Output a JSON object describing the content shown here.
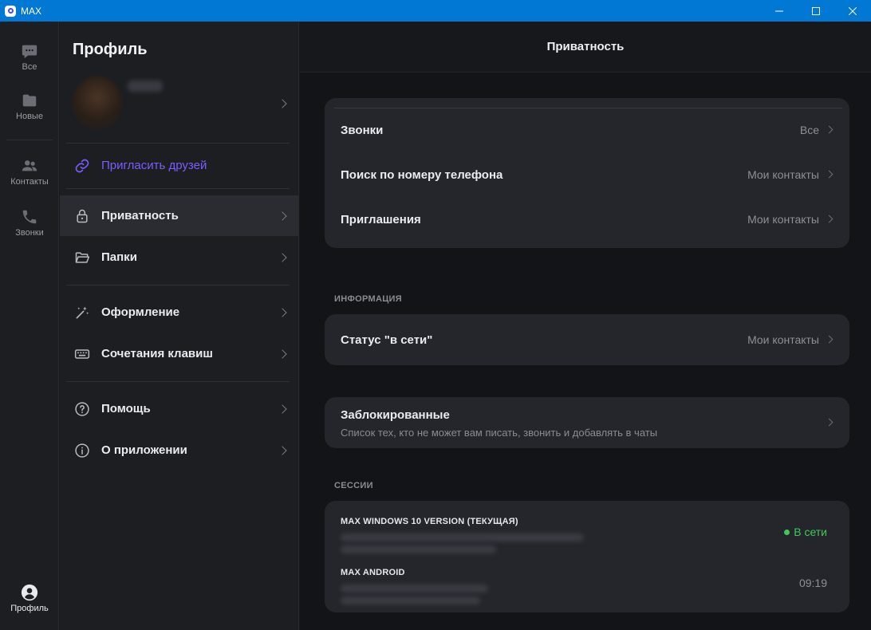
{
  "window": {
    "title": "MAX"
  },
  "rail": {
    "items": [
      {
        "label": "Все",
        "icon": "chat-bubble-icon"
      },
      {
        "label": "Новые",
        "icon": "folder-icon"
      },
      {
        "label": "Контакты",
        "icon": "contacts-icon"
      },
      {
        "label": "Звонки",
        "icon": "phone-icon"
      }
    ],
    "profile_label": "Профиль"
  },
  "profile": {
    "title": "Профиль",
    "invite_label": "Пригласить друзей",
    "menu": [
      {
        "label": "Приватность",
        "icon": "lock-icon",
        "active": true
      },
      {
        "label": "Папки",
        "icon": "folder-open-icon"
      },
      {
        "label": "Оформление",
        "icon": "magic-wand-icon"
      },
      {
        "label": "Сочетания клавиш",
        "icon": "keyboard-icon"
      },
      {
        "label": "Помощь",
        "icon": "help-icon"
      },
      {
        "label": "О приложении",
        "icon": "info-icon"
      }
    ]
  },
  "privacy": {
    "title": "Приватность",
    "rows": [
      {
        "label": "Звонки",
        "value": "Все"
      },
      {
        "label": "Поиск по номеру телефона",
        "value": "Мои контакты"
      },
      {
        "label": "Приглашения",
        "value": "Мои контакты"
      }
    ],
    "info_section": "ИНФОРМАЦИЯ",
    "status_row": {
      "label": "Статус \"в сети\"",
      "value": "Мои контакты"
    },
    "blocked": {
      "label": "Заблокированные",
      "description": "Список тех, кто не может вам писать, звонить и добавлять в чаты"
    },
    "sessions_section": "СЕССИИ",
    "sessions": [
      {
        "name": "MAX WINDOWS 10 VERSION (ТЕКУЩАЯ)",
        "status": "В сети"
      },
      {
        "name": "MAX ANDROID",
        "status": "09:19"
      }
    ]
  },
  "colors": {
    "accent": "#7b5cff",
    "online": "#3ec95b",
    "titlebar": "#0078d4"
  }
}
